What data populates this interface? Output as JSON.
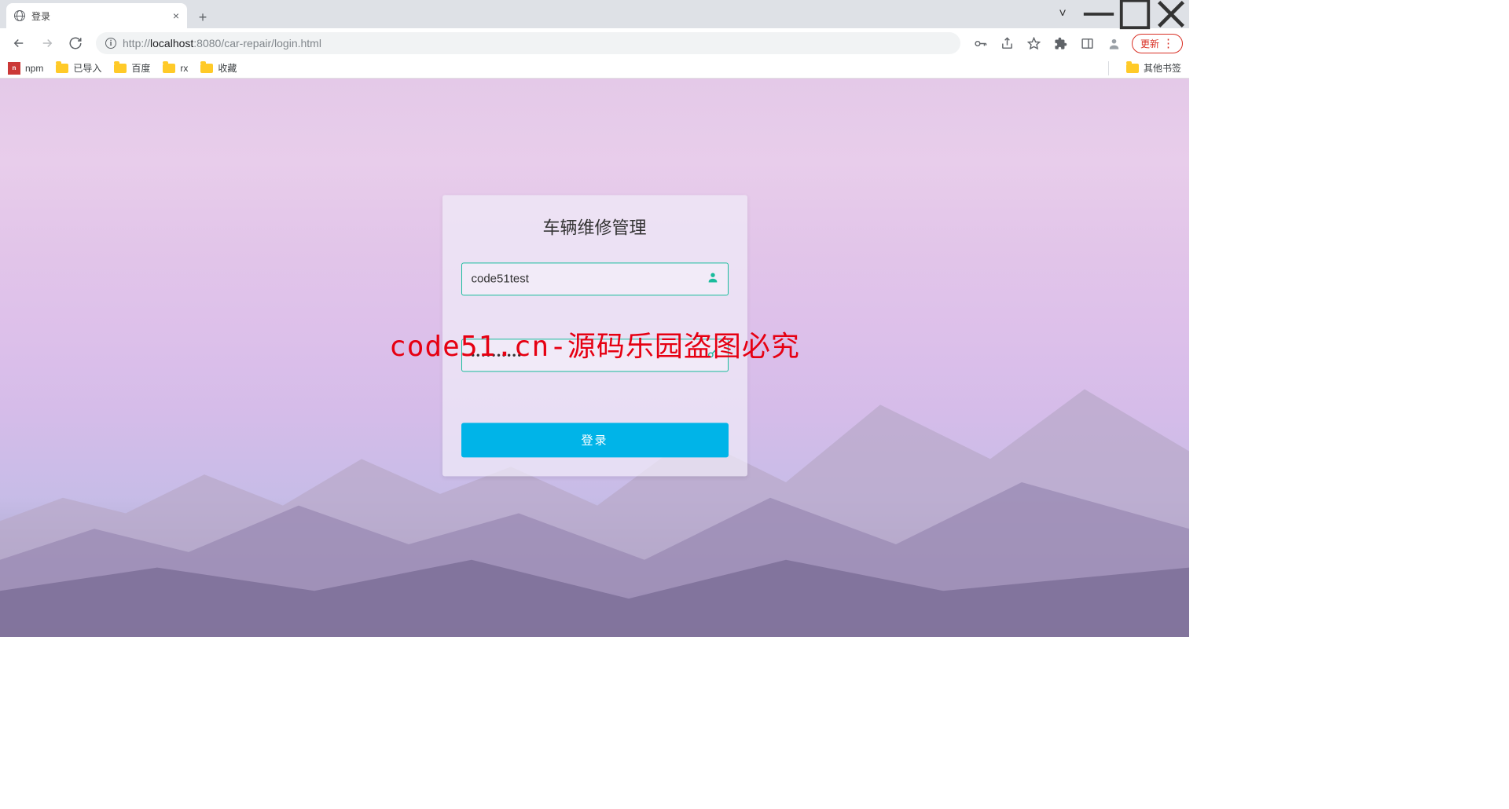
{
  "browser": {
    "tab_title": "登录",
    "url": {
      "scheme": "http://",
      "host": "localhost",
      "port": ":8080",
      "path": "/car-repair/login.html"
    },
    "update_label": "更新",
    "bookmarks": [
      {
        "label": "npm",
        "type": "npm"
      },
      {
        "label": "已导入",
        "type": "folder"
      },
      {
        "label": "百度",
        "type": "folder"
      },
      {
        "label": "rx",
        "type": "folder"
      },
      {
        "label": "收藏",
        "type": "folder"
      }
    ],
    "other_bookmarks_label": "其他书签"
  },
  "login": {
    "title": "车辆维修管理",
    "username_value": "code51test",
    "password_value": "••••••••••",
    "submit_label": "登录"
  },
  "watermark_text": "code51.cn-源码乐园盗图必究"
}
